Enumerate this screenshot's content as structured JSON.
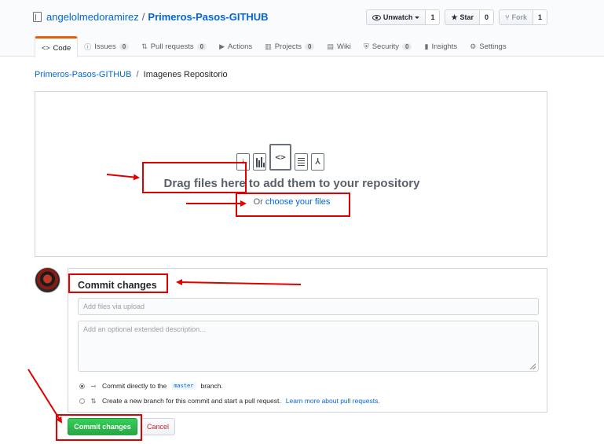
{
  "repo": {
    "owner": "angelolmedoramirez",
    "separator": "/",
    "name": "Primeros-Pasos-GITHUB"
  },
  "actions": {
    "watch_label": "Unwatch",
    "watch_count": "1",
    "star_label": "Star",
    "star_count": "0",
    "fork_label": "Fork",
    "fork_count": "1"
  },
  "nav": {
    "tabs": [
      {
        "label": "Code",
        "icon": "code-icon",
        "badge": ""
      },
      {
        "label": "Issues",
        "icon": "issue-icon",
        "badge": "0"
      },
      {
        "label": "Pull requests",
        "icon": "pull-request-icon",
        "badge": "0"
      },
      {
        "label": "Actions",
        "icon": "play-icon",
        "badge": ""
      },
      {
        "label": "Projects",
        "icon": "project-icon",
        "badge": "0"
      },
      {
        "label": "Wiki",
        "icon": "book-icon",
        "badge": ""
      },
      {
        "label": "Security",
        "icon": "shield-icon",
        "badge": "0"
      },
      {
        "label": "Insights",
        "icon": "graph-icon",
        "badge": ""
      },
      {
        "label": "Settings",
        "icon": "gear-icon",
        "badge": ""
      }
    ]
  },
  "breadcrumb": {
    "repo_link": "Primeros-Pasos-GITHUB",
    "separator": "/",
    "folder": "Imagenes Repositorio"
  },
  "dropzone": {
    "drag_text": "Drag files here to add them to your repository",
    "or_text": "Or",
    "choose_link": "choose your files"
  },
  "commit": {
    "title": "Commit changes",
    "summary_placeholder": "Add files via upload",
    "description_placeholder": "Add an optional extended description...",
    "option_direct_prefix": "Commit directly to the",
    "branch": "master",
    "option_direct_suffix": "branch.",
    "option_new_text": "Create a new branch for this commit and start a pull request.",
    "option_new_link": "Learn more about pull requests.",
    "submit_label": "Commit changes",
    "cancel_label": "Cancel"
  },
  "colors": {
    "accent": "#0366d6",
    "primary_button": "#28a745",
    "annotation": "#e00000",
    "selected_tab_border": "#e36209"
  }
}
